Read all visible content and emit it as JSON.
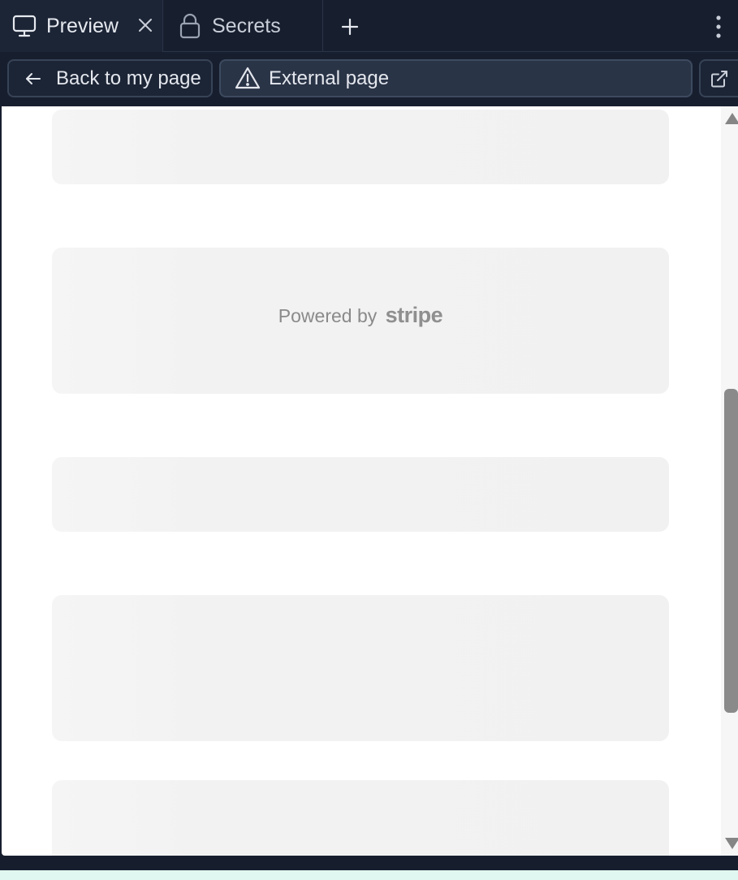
{
  "tabs": [
    {
      "label": "Preview",
      "icon": "monitor-icon",
      "active": true
    },
    {
      "label": "Secrets",
      "icon": "lock-icon",
      "active": false
    }
  ],
  "toolbar": {
    "back_label": "Back to my page",
    "external_label": "External page"
  },
  "viewport": {
    "powered_prefix": "Powered by",
    "powered_brand": "stripe"
  },
  "colors": {
    "chrome_bg": "#171f2f",
    "pill_border": "#374356",
    "skeleton": "#f2f2f2",
    "scroll_thumb": "#8a8a8a"
  }
}
